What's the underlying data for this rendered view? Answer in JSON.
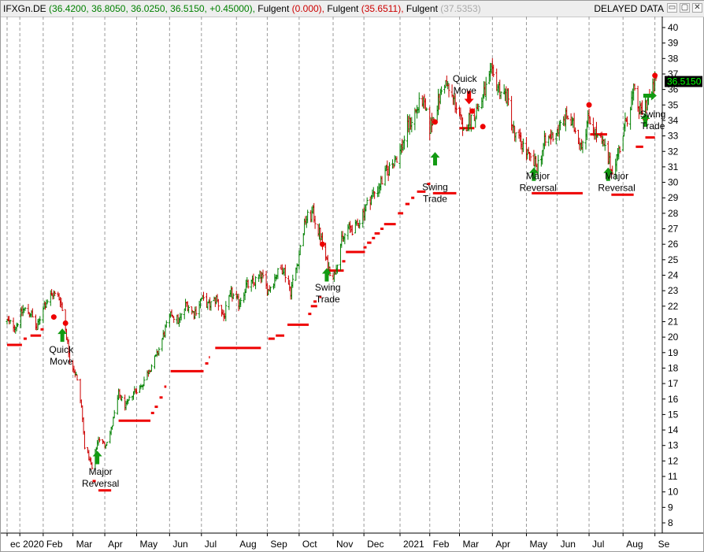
{
  "header": {
    "symbol": "IFXGn.DE",
    "ohlc": "(36.4200, 36.8050, 36.0250, 36.5150, +0.45000),",
    "ind1_name": "Fulgent",
    "ind1_value": "(0.000),",
    "ind2_name": "Fulgent",
    "ind2_value": "(35.6511),",
    "ind3_name": "Fulgent",
    "ind3_value": "(37.5353)",
    "status": "DELAYED DATA",
    "colors": {
      "symbol": "#000000",
      "ohlc": "#008000",
      "ind1": "#cc0000",
      "ind2": "#cc0000",
      "ind3": "#aaaaaa"
    }
  },
  "window_buttons": {
    "minimize": "▭",
    "maximize": "▢",
    "close": "✕"
  },
  "chart_data": {
    "type": "bar",
    "subtype": "ohlc",
    "y_axis": {
      "position": "right",
      "ticks": [
        8,
        9,
        10,
        11,
        12,
        13,
        14,
        15,
        16,
        17,
        18,
        19,
        20,
        21,
        22,
        23,
        24,
        25,
        26,
        27,
        28,
        29,
        30,
        31,
        32,
        33,
        34,
        35,
        36,
        37,
        38,
        39,
        40
      ],
      "ylim": [
        7.5,
        40.5
      ]
    },
    "x_axis": {
      "tick_labels": [
        {
          "label": "ec",
          "x": "2019-12-31"
        },
        {
          "label": "2020",
          "x": "2020-01-12"
        },
        {
          "label": "Feb",
          "x": "2020-02-03"
        },
        {
          "label": "Mar",
          "x": "2020-03-02"
        },
        {
          "label": "Apr",
          "x": "2020-04-01"
        },
        {
          "label": "May",
          "x": "2020-05-01"
        },
        {
          "label": "Jun",
          "x": "2020-06-01"
        },
        {
          "label": "Jul",
          "x": "2020-07-01"
        },
        {
          "label": "Aug",
          "x": "2020-08-03"
        },
        {
          "label": "Sep",
          "x": "2020-09-01"
        },
        {
          "label": "Oct",
          "x": "2020-10-01"
        },
        {
          "label": "Nov",
          "x": "2020-11-02"
        },
        {
          "label": "Dec",
          "x": "2020-12-01"
        },
        {
          "label": "2021",
          "x": "2021-01-04"
        },
        {
          "label": "Feb",
          "x": "2021-02-01"
        },
        {
          "label": "Mar",
          "x": "2021-03-01"
        },
        {
          "label": "Apr",
          "x": "2021-04-01"
        },
        {
          "label": "May",
          "x": "2021-05-03"
        },
        {
          "label": "Jun",
          "x": "2021-06-01"
        },
        {
          "label": "Jul",
          "x": "2021-07-01"
        },
        {
          "label": "Aug",
          "x": "2021-08-02"
        },
        {
          "label": "Se",
          "x": "2021-09-01"
        }
      ]
    },
    "grid": {
      "vertical": true,
      "horizontal": false,
      "style": "dashed"
    },
    "last_price": {
      "label": "36.5150",
      "value": 36.515,
      "color": "#000000",
      "text_color": "#00ff00"
    },
    "up_color": "#008000",
    "down_color": "#cc0000",
    "price_path": [
      [
        "2019-12-31",
        21.0
      ],
      [
        "2020-01-08",
        20.7
      ],
      [
        "2020-01-15",
        21.8
      ],
      [
        "2020-01-22",
        21.6
      ],
      [
        "2020-01-28",
        20.5
      ],
      [
        "2020-02-03",
        22.0
      ],
      [
        "2020-02-12",
        22.8
      ],
      [
        "2020-02-19",
        22.5
      ],
      [
        "2020-02-24",
        20.6
      ],
      [
        "2020-02-28",
        18.6
      ],
      [
        "2020-03-05",
        17.5
      ],
      [
        "2020-03-10",
        15.5
      ],
      [
        "2020-03-13",
        13.0
      ],
      [
        "2020-03-18",
        12.0
      ],
      [
        "2020-03-20",
        11.5
      ],
      [
        "2020-03-26",
        13.5
      ],
      [
        "2020-04-01",
        13.0
      ],
      [
        "2020-04-07",
        14.0
      ],
      [
        "2020-04-14",
        16.3
      ],
      [
        "2020-04-21",
        15.5
      ],
      [
        "2020-04-28",
        16.5
      ],
      [
        "2020-05-05",
        16.8
      ],
      [
        "2020-05-12",
        17.8
      ],
      [
        "2020-05-20",
        18.8
      ],
      [
        "2020-05-28",
        20.5
      ],
      [
        "2020-06-03",
        21.5
      ],
      [
        "2020-06-10",
        21.0
      ],
      [
        "2020-06-17",
        22.2
      ],
      [
        "2020-06-24",
        21.5
      ],
      [
        "2020-07-01",
        22.5
      ],
      [
        "2020-07-08",
        22.0
      ],
      [
        "2020-07-15",
        22.5
      ],
      [
        "2020-07-22",
        21.3
      ],
      [
        "2020-07-29",
        22.8
      ],
      [
        "2020-08-05",
        22.2
      ],
      [
        "2020-08-12",
        23.3
      ],
      [
        "2020-08-19",
        23.5
      ],
      [
        "2020-08-26",
        24.0
      ],
      [
        "2020-09-02",
        23.0
      ],
      [
        "2020-09-09",
        24.0
      ],
      [
        "2020-09-16",
        24.5
      ],
      [
        "2020-09-23",
        23.0
      ],
      [
        "2020-09-30",
        25.0
      ],
      [
        "2020-10-07",
        27.6
      ],
      [
        "2020-10-14",
        28.0
      ],
      [
        "2020-10-21",
        26.5
      ],
      [
        "2020-10-28",
        24.5
      ],
      [
        "2020-11-03",
        24.0
      ],
      [
        "2020-11-09",
        26.0
      ],
      [
        "2020-11-16",
        27.0
      ],
      [
        "2020-11-23",
        27.0
      ],
      [
        "2020-11-30",
        28.0
      ],
      [
        "2020-12-07",
        29.0
      ],
      [
        "2020-12-14",
        29.6
      ],
      [
        "2020-12-21",
        30.5
      ],
      [
        "2021-01-04",
        32.0
      ],
      [
        "2021-01-11",
        33.5
      ],
      [
        "2021-01-18",
        34.5
      ],
      [
        "2021-01-25",
        35.3
      ],
      [
        "2021-02-01",
        33.5
      ],
      [
        "2021-02-08",
        35.0
      ],
      [
        "2021-02-15",
        36.5
      ],
      [
        "2021-02-22",
        35.5
      ],
      [
        "2021-03-01",
        34.5
      ],
      [
        "2021-03-04",
        33.0
      ],
      [
        "2021-03-09",
        34.0
      ],
      [
        "2021-03-16",
        34.5
      ],
      [
        "2021-03-23",
        35.5
      ],
      [
        "2021-03-31",
        37.0
      ],
      [
        "2021-04-08",
        36.0
      ],
      [
        "2021-04-15",
        35.5
      ],
      [
        "2021-04-22",
        33.0
      ],
      [
        "2021-04-29",
        32.5
      ],
      [
        "2021-05-06",
        31.5
      ],
      [
        "2021-05-13",
        31.0
      ],
      [
        "2021-05-20",
        32.5
      ],
      [
        "2021-05-27",
        33.0
      ],
      [
        "2021-06-03",
        33.5
      ],
      [
        "2021-06-10",
        34.3
      ],
      [
        "2021-06-17",
        33.5
      ],
      [
        "2021-06-24",
        32.5
      ],
      [
        "2021-07-01",
        34.3
      ],
      [
        "2021-07-08",
        33.0
      ],
      [
        "2021-07-15",
        32.3
      ],
      [
        "2021-07-22",
        30.8
      ],
      [
        "2021-07-29",
        32.0
      ],
      [
        "2021-08-05",
        34.0
      ],
      [
        "2021-08-12",
        35.8
      ],
      [
        "2021-08-18",
        34.5
      ],
      [
        "2021-08-24",
        35.2
      ],
      [
        "2021-08-30",
        36.0
      ],
      [
        "2021-09-02",
        36.5
      ]
    ],
    "stop_segments": [
      {
        "from": "2019-12-31",
        "to": "2020-01-14",
        "y": 19.5
      },
      {
        "from": "2020-01-22",
        "to": "2020-02-01",
        "y": 20.1
      },
      {
        "from": "2020-03-26",
        "to": "2020-04-07",
        "y": 10.1
      },
      {
        "from": "2020-04-14",
        "to": "2020-05-14",
        "y": 14.6
      },
      {
        "from": "2020-05-18",
        "to": "2020-05-21",
        "y": 15.5
      },
      {
        "from": "2020-05-27",
        "to": "2020-05-29",
        "y": 16.8
      },
      {
        "from": "2020-06-02",
        "to": "2020-07-03",
        "y": 17.8
      },
      {
        "from": "2020-07-08",
        "to": "2020-07-09",
        "y": 18.7
      },
      {
        "from": "2020-07-14",
        "to": "2020-08-26",
        "y": 19.3
      },
      {
        "from": "2020-09-02",
        "to": "2020-09-08",
        "y": 19.9
      },
      {
        "from": "2020-09-09",
        "to": "2020-09-17",
        "y": 20.1
      },
      {
        "from": "2020-09-20",
        "to": "2020-10-10",
        "y": 20.8
      },
      {
        "from": "2020-10-12",
        "to": "2020-10-18",
        "y": 22.0
      },
      {
        "from": "2020-10-20",
        "to": "2020-10-22",
        "y": 22.6
      },
      {
        "from": "2020-10-26",
        "to": "2020-11-12",
        "y": 24.3
      },
      {
        "from": "2020-11-14",
        "to": "2020-12-02",
        "y": 25.5
      },
      {
        "from": "2020-12-04",
        "to": "2020-12-08",
        "y": 26.1
      },
      {
        "from": "2020-12-11",
        "to": "2020-12-16",
        "y": 26.7
      },
      {
        "from": "2020-12-20",
        "to": "2020-12-31",
        "y": 27.3
      },
      {
        "from": "2021-01-02",
        "to": "2021-01-07",
        "y": 28.0
      },
      {
        "from": "2021-01-09",
        "to": "2021-01-13",
        "y": 28.6
      },
      {
        "from": "2021-01-20",
        "to": "2021-01-28",
        "y": 29.4
      },
      {
        "from": "2021-02-04",
        "to": "2021-02-26",
        "y": 29.3
      },
      {
        "from": "2021-03-01",
        "to": "2021-03-15",
        "y": 33.5
      },
      {
        "from": "2021-05-08",
        "to": "2021-06-25",
        "y": 29.3
      },
      {
        "from": "2021-07-02",
        "to": "2021-07-18",
        "y": 33.1
      },
      {
        "from": "2021-07-22",
        "to": "2021-08-12",
        "y": 29.2
      },
      {
        "from": "2021-08-14",
        "to": "2021-08-21",
        "y": 32.3
      },
      {
        "from": "2021-08-23",
        "to": "2021-09-01",
        "y": 32.9
      }
    ],
    "stop_dots": [
      [
        "2020-01-17",
        19.9
      ],
      [
        "2020-02-02",
        20.5
      ],
      [
        "2020-03-22",
        10.7
      ],
      [
        "2020-05-16",
        15.1
      ],
      [
        "2020-05-24",
        16.1
      ],
      [
        "2020-07-06",
        18.3
      ],
      [
        "2020-10-11",
        21.5
      ],
      [
        "2020-10-16",
        22.3
      ],
      [
        "2020-11-12",
        24.9
      ],
      [
        "2020-12-02",
        25.8
      ],
      [
        "2020-12-10",
        26.4
      ],
      [
        "2020-12-18",
        27.0
      ],
      [
        "2021-01-16",
        29.0
      ],
      [
        "2021-01-31",
        29.9
      ]
    ],
    "signal_dots": [
      [
        "2020-02-13",
        21.3
      ],
      [
        "2020-02-24",
        20.9
      ],
      [
        "2020-10-23",
        26.0
      ],
      [
        "2021-02-06",
        33.9
      ],
      [
        "2021-03-13",
        34.6
      ],
      [
        "2021-03-23",
        33.6
      ],
      [
        "2021-07-01",
        35.0
      ],
      [
        "2021-08-23",
        34.1
      ],
      [
        "2021-09-01",
        36.9
      ]
    ],
    "buy_arrows": [
      [
        "2020-02-21",
        20.1
      ],
      [
        "2020-03-25",
        12.2
      ],
      [
        "2020-10-27",
        24.0
      ],
      [
        "2021-02-06",
        31.5
      ],
      [
        "2021-05-10",
        30.5
      ],
      [
        "2021-07-19",
        30.5
      ],
      [
        "2021-08-23",
        34.0
      ]
    ],
    "sell_arrows": [
      [
        "2021-03-10",
        35.5
      ]
    ],
    "right_arrows": [
      [
        "2021-08-27",
        35.6
      ]
    ],
    "annotations": [
      {
        "lines": [
          "Quick",
          "Move"
        ],
        "x": "2020-02-20",
        "y": 19.0
      },
      {
        "lines": [
          "Major",
          "Reversal"
        ],
        "x": "2020-03-28",
        "y": 11.1
      },
      {
        "lines": [
          "Swing",
          "Trade"
        ],
        "x": "2020-10-28",
        "y": 23.0
      },
      {
        "lines": [
          "Swing",
          "Trade"
        ],
        "x": "2021-02-06",
        "y": 29.5
      },
      {
        "lines": [
          "Quick",
          "Move"
        ],
        "x": "2021-03-06",
        "y": 36.5
      },
      {
        "lines": [
          "Major",
          "Reversal"
        ],
        "x": "2021-05-14",
        "y": 30.2
      },
      {
        "lines": [
          "Major",
          "Reversal"
        ],
        "x": "2021-07-27",
        "y": 30.2
      },
      {
        "lines": [
          "Swing",
          "Trade"
        ],
        "x": "2021-08-30",
        "y": 34.2
      }
    ]
  }
}
